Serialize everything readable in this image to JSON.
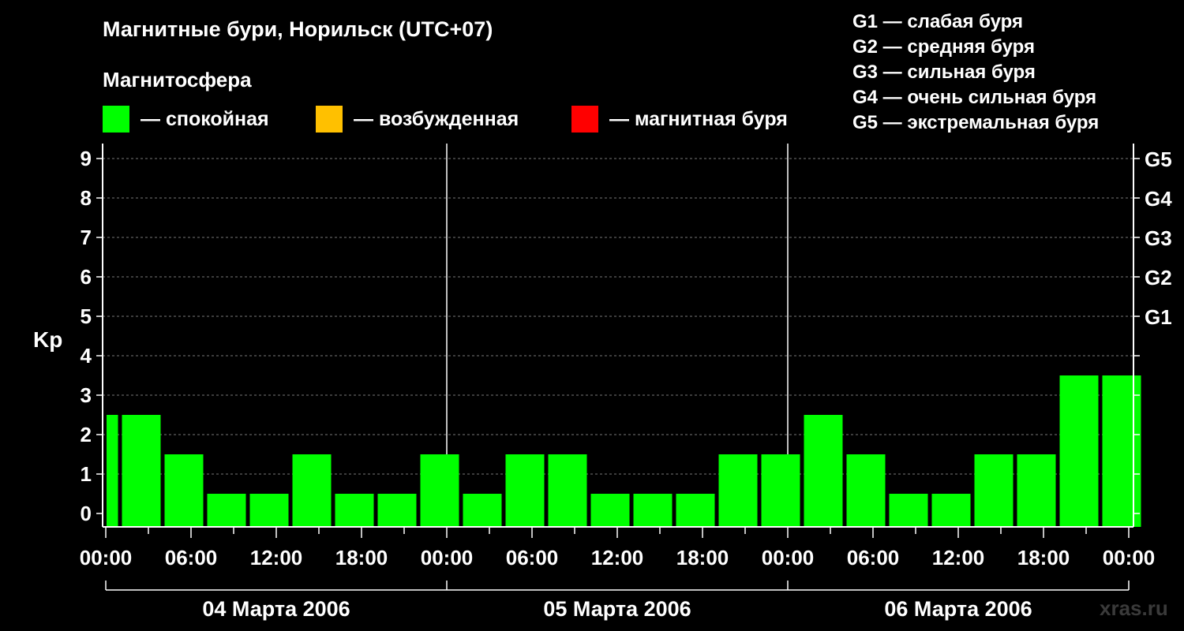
{
  "title": "Магнитные бури, Норильск (UTC+07)",
  "legend": {
    "heading": "Магнитосфера",
    "items": [
      {
        "label": "— спокойная",
        "color": "#00ff00"
      },
      {
        "label": "— возбужденная",
        "color": "#ffc000"
      },
      {
        "label": "— магнитная буря",
        "color": "#ff0000"
      }
    ]
  },
  "storm_levels": [
    "G1 — слабая буря",
    "G2 — средняя буря",
    "G3 — сильная буря",
    "G4 — очень сильная буря",
    "G5 — экстремальная буря"
  ],
  "watermark": "xras.ru",
  "chart_data": {
    "type": "bar",
    "ylabel": "Kp",
    "ylim": [
      0,
      9
    ],
    "y_ticks": [
      "0",
      "1",
      "2",
      "3",
      "4",
      "5",
      "6",
      "7",
      "8",
      "9"
    ],
    "right_ticks": [
      {
        "kp": 5,
        "label": "G1"
      },
      {
        "kp": 6,
        "label": "G2"
      },
      {
        "kp": 7,
        "label": "G3"
      },
      {
        "kp": 8,
        "label": "G4"
      },
      {
        "kp": 9,
        "label": "G5"
      }
    ],
    "x_tick_labels": [
      "00:00",
      "06:00",
      "12:00",
      "18:00",
      "00:00",
      "06:00",
      "12:00",
      "18:00",
      "00:00",
      "06:00",
      "12:00",
      "18:00",
      "00:00"
    ],
    "days": [
      "04 Марта 2006",
      "05 Марта 2006",
      "06 Марта 2006"
    ],
    "bar_color": "#00ff00",
    "interval_hours": 3,
    "partial_first_interval_hours": 1,
    "values": [
      2,
      2,
      1,
      0,
      0,
      1,
      0,
      0,
      1,
      0,
      1,
      1,
      0,
      0,
      0,
      1,
      1,
      2,
      1,
      0,
      0,
      1,
      1,
      3,
      3
    ],
    "grid": true
  }
}
